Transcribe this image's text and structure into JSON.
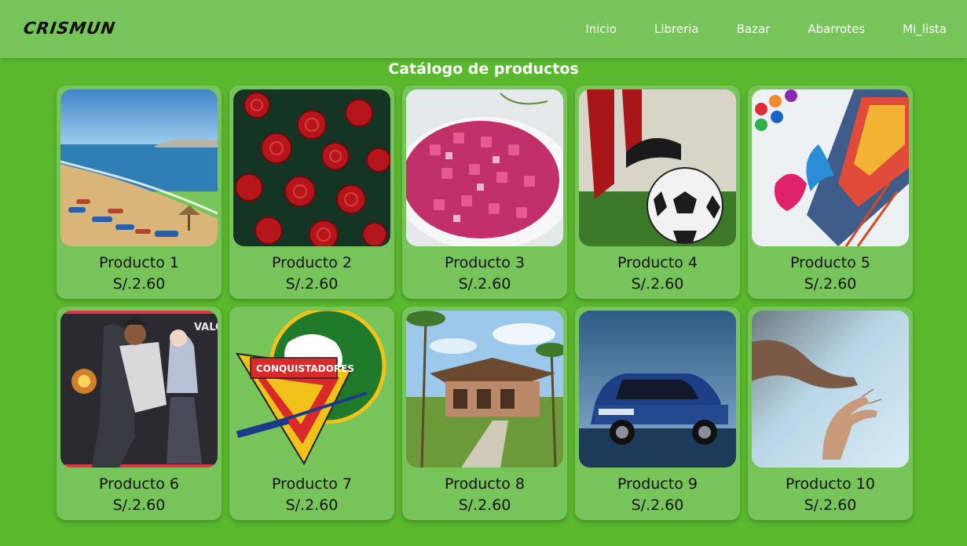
{
  "brand": {
    "logo_text": "CRISMUN"
  },
  "nav": {
    "items": [
      {
        "label": "Inicio"
      },
      {
        "label": "Libreria"
      },
      {
        "label": "Bazar"
      },
      {
        "label": "Abarrotes"
      },
      {
        "label": "Mi_lista"
      }
    ]
  },
  "page_title": "Catálogo de productos",
  "colors": {
    "background": "#5ab82e",
    "navbar": "#77c45a",
    "card": "#77c45a"
  },
  "products": [
    {
      "name": "Producto 1",
      "price": "S/.2.60",
      "image": "beach-photo"
    },
    {
      "name": "Producto 2",
      "price": "S/.2.60",
      "image": "red-roses-photo"
    },
    {
      "name": "Producto 3",
      "price": "S/.2.60",
      "image": "beet-salad-photo"
    },
    {
      "name": "Producto 4",
      "price": "S/.2.60",
      "image": "soccer-ball-photo"
    },
    {
      "name": "Producto 5",
      "price": "S/.2.60",
      "image": "watercolor-art-photo"
    },
    {
      "name": "Producto 6",
      "price": "S/.2.60",
      "image": "valorant-characters-image"
    },
    {
      "name": "Producto 7",
      "price": "S/.2.60",
      "image": "conquistadores-logo"
    },
    {
      "name": "Producto 8",
      "price": "S/.2.60",
      "image": "house-photo"
    },
    {
      "name": "Producto 9",
      "price": "S/.2.60",
      "image": "blue-suv-photo"
    },
    {
      "name": "Producto 10",
      "price": "S/.2.60",
      "image": "hands-reaching-photo"
    }
  ]
}
